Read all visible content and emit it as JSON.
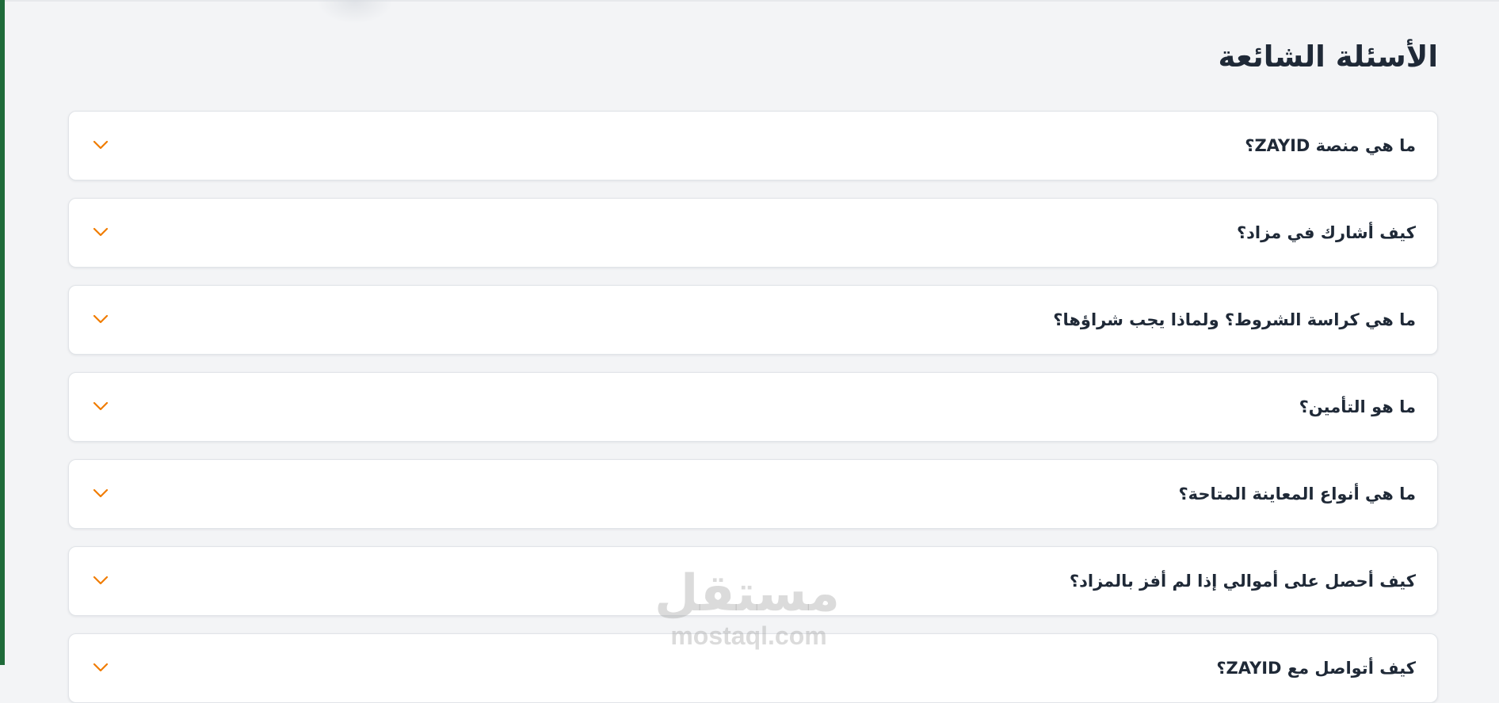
{
  "faq": {
    "title": "الأسئلة الشائعة",
    "items": [
      {
        "question": "ما هي منصة ZAYID؟"
      },
      {
        "question": "كيف أشارك في مزاد؟"
      },
      {
        "question": "ما هي كراسة الشروط؟ ولماذا يجب شراؤها؟"
      },
      {
        "question": "ما هو التأمين؟"
      },
      {
        "question": "ما هي أنواع المعاينة المتاحة؟"
      },
      {
        "question": "كيف أحصل على أموالي إذا لم أفز بالمزاد؟"
      },
      {
        "question": "كيف أتواصل مع ZAYID؟"
      }
    ],
    "expand_icon": "chevron-down-icon"
  },
  "watermark": {
    "logo_text": "مستقل",
    "url_text": "mostaql.com"
  },
  "colors": {
    "accent": "#f07c00",
    "page_background": "#f3f4f6",
    "card_background": "#ffffff",
    "text": "#1f2937",
    "left_bar": "#1f6b3a"
  }
}
